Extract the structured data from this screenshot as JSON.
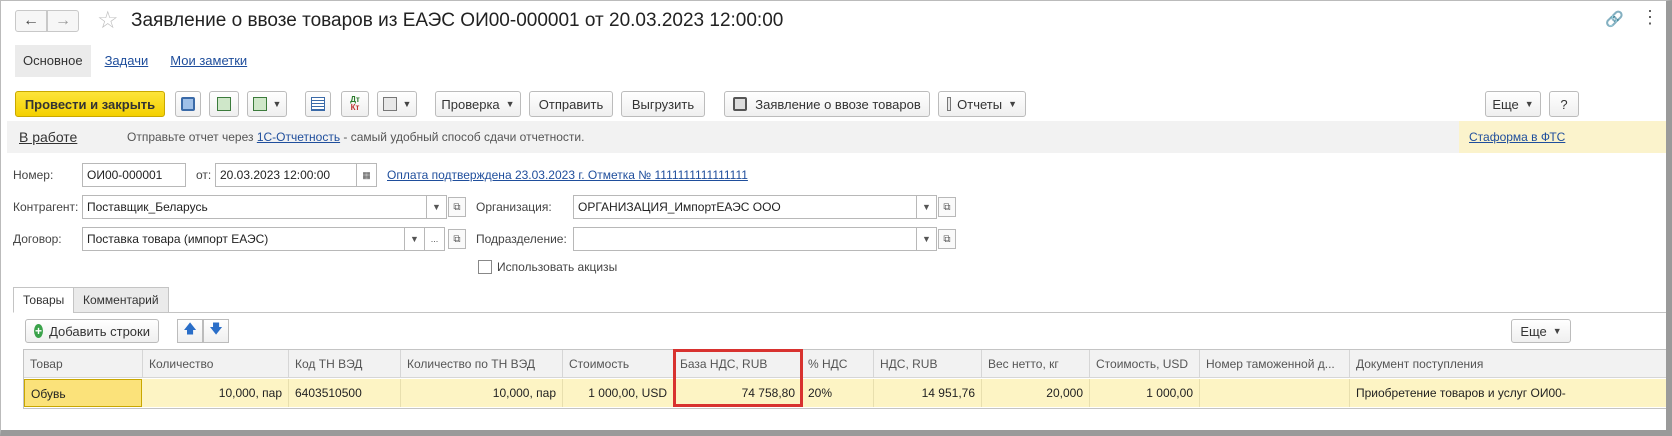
{
  "window": {
    "title": "Заявление о ввозе товаров из ЕАЭС ОИ00-000001 от 20.03.2023 12:00:00"
  },
  "sections": [
    "Основное",
    "Задачи",
    "Мои заметки"
  ],
  "toolbar": {
    "post_close": "Провести и закрыть",
    "check": "Проверка",
    "send": "Отправить",
    "export": "Выгрузить",
    "print_form": "Заявление о ввозе товаров",
    "reports": "Отчеты",
    "more": "Еще",
    "help": "?"
  },
  "info": {
    "status": "В работе",
    "text_before": "Отправьте отчет через ",
    "link": "1С-Отчетность",
    "text_after": " - самый удобный способ сдачи отчетности.",
    "staforma": "Стаформа в ФТС"
  },
  "form": {
    "number_label": "Номер:",
    "number_value": "ОИ00-000001",
    "date_label": "от:",
    "date_value": "20.03.2023 12:00:00",
    "payment_link": "Оплата подтверждена 23.03.2023 г. Отметка № 1111111111111111",
    "counterparty_label": "Контрагент:",
    "counterparty_value": "Поставщик_Беларусь",
    "organization_label": "Организация:",
    "organization_value": "ОРГАНИЗАЦИЯ_ИмпортЕАЭС ООО",
    "contract_label": "Договор:",
    "contract_value": "Поставка товара (импорт ЕАЭС)",
    "division_label": "Подразделение:",
    "division_value": "",
    "excise_label": "Использовать акцизы"
  },
  "tabs": [
    "Товары",
    "Комментарий"
  ],
  "goods": {
    "add_rows": "Добавить строки",
    "more": "Еще",
    "columns": [
      "Товар",
      "Количество",
      "Код ТН ВЭД",
      "Количество по ТН ВЭД",
      "Стоимость",
      "База НДС, RUB",
      "% НДС",
      "НДС, RUB",
      "Вес нетто, кг",
      "Стоимость, USD",
      "Номер таможенной д...",
      "Документ поступления"
    ],
    "rows": [
      [
        "Обувь",
        "10,000, пар",
        "6403510500",
        "10,000, пар",
        "1 000,00, USD",
        "74 758,80",
        "20%",
        "14 951,76",
        "20,000",
        "1 000,00",
        "",
        "Приобретение товаров и услуг ОИ00-"
      ]
    ]
  }
}
